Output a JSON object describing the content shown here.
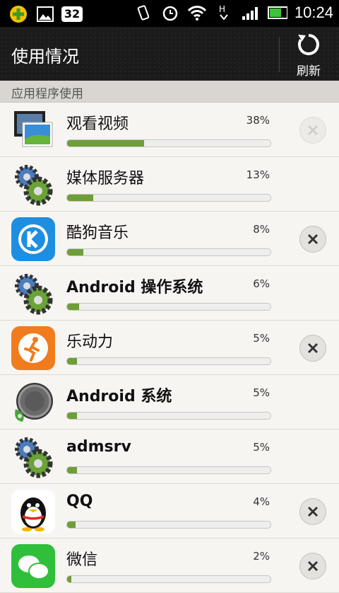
{
  "status_bar": {
    "time": "10:24",
    "badge": "32"
  },
  "header": {
    "title": "使用情况",
    "refresh_label": "刷新"
  },
  "section": {
    "title": "应用程序使用"
  },
  "apps": [
    {
      "name": "观看视频",
      "percent": "38%",
      "value": 38,
      "icon": "video-icon",
      "closable": true,
      "close_enabled": false
    },
    {
      "name": "媒体服务器",
      "percent": "13%",
      "value": 13,
      "icon": "gears-icon",
      "closable": false
    },
    {
      "name": "酷狗音乐",
      "percent": "8%",
      "value": 8,
      "icon": "kugou-icon",
      "closable": true,
      "close_enabled": true
    },
    {
      "name": "Android 操作系统",
      "percent": "6%",
      "value": 6,
      "icon": "gears-icon",
      "closable": false
    },
    {
      "name": "乐动力",
      "percent": "5%",
      "value": 5,
      "icon": "ledongli-icon",
      "closable": true,
      "close_enabled": true
    },
    {
      "name": "Android 系统",
      "percent": "5%",
      "value": 5,
      "icon": "android-system-icon",
      "closable": false
    },
    {
      "name": "admsrv",
      "percent": "5%",
      "value": 5,
      "icon": "gears-icon",
      "closable": false
    },
    {
      "name": "QQ",
      "percent": "4%",
      "value": 4,
      "icon": "qq-penguin-icon",
      "closable": true,
      "close_enabled": true
    },
    {
      "name": "微信",
      "percent": "2%",
      "value": 2,
      "icon": "wechat-icon",
      "closable": true,
      "close_enabled": true
    }
  ],
  "colors": {
    "bar_fill": "#6e9e3a",
    "header_bg": "#1b1b1b"
  }
}
